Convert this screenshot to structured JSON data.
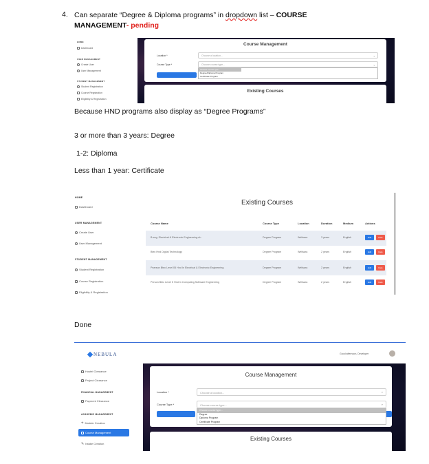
{
  "heading": {
    "number": "4.",
    "text_before": "Can separate “Degree & Diploma programs” in ",
    "squiggle_word": "dropdown",
    "text_after": " list – ",
    "bold": "COURSE",
    "bold2": "MANAGEMENT",
    "dash": "- ",
    "status": "pending"
  },
  "para1": "Because HND programs also display as “Degree Programs”",
  "rules": [
    "3 or more than 3 years: Degree",
    "1-2: Diploma",
    "Less than 1 year: Certificate"
  ],
  "done_label": "Done",
  "shot1": {
    "sidebar": {
      "sections": [
        {
          "title": "HOME",
          "items": [
            "Dashboard"
          ]
        },
        {
          "title": "USER MANAGEMENT",
          "items": [
            "Create User",
            "User Management"
          ]
        },
        {
          "title": "STUDENT MANAGEMENT",
          "items": [
            "Student Registration",
            "Course Registration",
            "Eligibility & Registration"
          ]
        }
      ]
    },
    "card_title": "Course Management",
    "location_label": "Location *",
    "location_placeholder": "Choose a location...",
    "course_type_label": "Course Type *",
    "course_type_placeholder": "Choose course type...",
    "options": [
      "Choose course type...",
      "Degree/Diploma Program",
      "Certificate Program"
    ],
    "existing_title": "Existing Courses"
  },
  "shot2": {
    "sidebar": {
      "sections": [
        {
          "title": "HOME",
          "items": [
            "Dashboard"
          ]
        },
        {
          "title": "USER MANAGEMENT",
          "items": [
            "Create User",
            "User Management"
          ]
        },
        {
          "title": "STUDENT MANAGEMENT",
          "items": [
            "Student Registration",
            "Course Registration",
            "Eligibility & Registration"
          ]
        }
      ]
    },
    "title": "Existing Courses",
    "headers": [
      "Course Name",
      "Course Type",
      "Location",
      "Duration",
      "Medium",
      "Actions"
    ],
    "rows": [
      [
        "B.eng. Electrical & Electronic Engineering-uh",
        "Degree Program",
        "Welisara",
        "3 years",
        "English"
      ],
      [
        "Btec Hnd Digital Technology",
        "Degree Program",
        "Welisara",
        "2 years",
        "English"
      ],
      [
        "Pearson Btec Level 05 Hnd In Electrical & Electronic Engineering",
        "Degree Program",
        "Welisara",
        "2 years",
        "English"
      ],
      [
        "Person Btec Level 5 Hnd In Computing Software Engineering",
        "Degree Program",
        "Welisara",
        "2 years",
        "English"
      ]
    ],
    "edit_label": "Edit",
    "delete_label": "Dele"
  },
  "shot3": {
    "logo": "NEBULA",
    "greeting": "Good afternoon, Developer",
    "sidebar": [
      {
        "type": "item",
        "label": "Hostel Clearance"
      },
      {
        "type": "item",
        "label": "Project Clearance"
      },
      {
        "type": "title",
        "label": "FINANCIAL MANAGEMENT"
      },
      {
        "type": "item",
        "label": "Payment Clearance"
      },
      {
        "type": "title",
        "label": "ACADEMIC MANAGEMENT"
      },
      {
        "type": "item",
        "label": "Module Creation"
      },
      {
        "type": "active",
        "label": "Course Management"
      },
      {
        "type": "item",
        "label": "Intake Creation"
      }
    ],
    "card_title": "Course Management",
    "location_label": "Location *",
    "location_placeholder": "Choose a location...",
    "course_type_label": "Course Type *",
    "course_type_placeholder": "Choose course type...",
    "options": [
      "Choose course type...",
      "Degree",
      "Diploma Program",
      "Certificate Program"
    ],
    "existing_title": "Existing Courses"
  },
  "colors": {
    "accent": "#2a78e4",
    "pending": "#e0201c",
    "delete": "#ef5b4b"
  }
}
